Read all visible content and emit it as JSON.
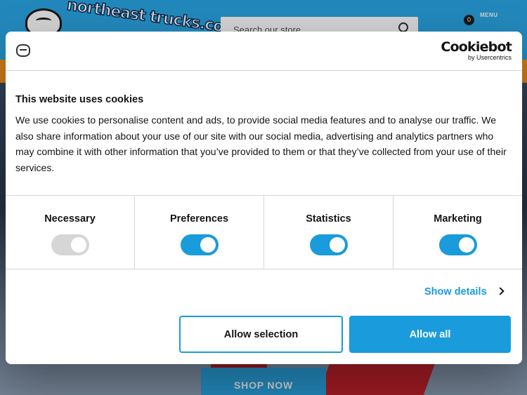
{
  "site": {
    "logo_text": "northeast trucks.co.uk",
    "search_placeholder": "Search our store...",
    "menu_label": "MENU",
    "cart_count": "0",
    "shop_now": "SHOP NOW"
  },
  "dialog": {
    "brand_main": "Cookiebot",
    "brand_sub": "by Usercentrics",
    "title": "This website uses cookies",
    "body": "We use cookies to personalise content and ads, to provide social media features and to analyse our traffic. We also share information about your use of our site with our social media, advertising and analytics partners who may combine it with other information that you’ve provided to them or that they’ve collected from your use of their services.",
    "categories": [
      {
        "label": "Necessary",
        "checked": true,
        "disabled": true
      },
      {
        "label": "Preferences",
        "checked": true,
        "disabled": false
      },
      {
        "label": "Statistics",
        "checked": true,
        "disabled": false
      },
      {
        "label": "Marketing",
        "checked": true,
        "disabled": false
      }
    ],
    "show_details": "Show details",
    "allow_selection": "Allow selection",
    "allow_all": "Allow all"
  },
  "colors": {
    "accent": "#1a9bdc",
    "header_blue": "#2aa6e4",
    "orange_bar": "#f7941d"
  }
}
